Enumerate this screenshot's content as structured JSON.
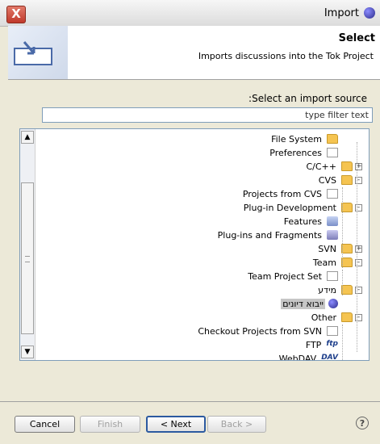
{
  "window": {
    "title": "Import",
    "close_label": "X"
  },
  "header": {
    "title": "Select",
    "description": "Imports discussions into the Tok Project"
  },
  "source": {
    "label": "Select an import source:",
    "filter_value": "type filter text"
  },
  "tree": [
    {
      "label": "File System",
      "icon": "folder-icon"
    },
    {
      "label": "Preferences",
      "icon": "preferences-icon"
    },
    {
      "label": "C/C++",
      "icon": "folder-icon",
      "toggle": "+"
    },
    {
      "label": "CVS",
      "icon": "folder-icon",
      "toggle": "-"
    },
    {
      "label": "Projects from CVS",
      "icon": "cvs-icon"
    },
    {
      "label": "Plug-in Development",
      "icon": "folder-icon",
      "toggle": "-"
    },
    {
      "label": "Features",
      "icon": "features-icon"
    },
    {
      "label": "Plug-ins and Fragments",
      "icon": "plugins-icon"
    },
    {
      "label": "SVN",
      "icon": "folder-icon",
      "toggle": "+"
    },
    {
      "label": "Team",
      "icon": "folder-icon",
      "toggle": "-"
    },
    {
      "label": "Team Project Set",
      "icon": "team-set-icon"
    },
    {
      "label": "מידע",
      "icon": "folder-icon",
      "toggle": "-"
    },
    {
      "label": "ייבוא דיונים",
      "icon": "tok-icon",
      "selected": true
    },
    {
      "label": "Other",
      "icon": "folder-icon",
      "toggle": "-"
    },
    {
      "label": "Checkout Projects from SVN",
      "icon": "svn-icon"
    },
    {
      "label": "FTP",
      "icon": "ftp-icon",
      "icon_text": "ftp"
    },
    {
      "label": "WebDAV",
      "icon": "webdav-icon",
      "icon_text": "DAV"
    }
  ],
  "buttons": {
    "cancel": "Cancel",
    "finish": "Finish",
    "next": "< Next",
    "back": "Back >",
    "help": "?"
  }
}
